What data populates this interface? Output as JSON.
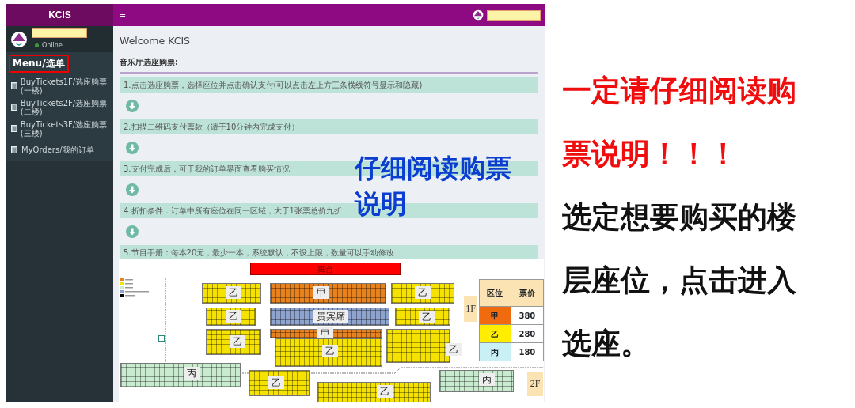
{
  "sidebar": {
    "brand": "KCIS",
    "user_status": "Online",
    "menu_title": "Menu/选单",
    "items": [
      {
        "label": "BuyTickets1F/选座购票(一楼)"
      },
      {
        "label": "BuyTickets2F/选座购票(二楼)"
      },
      {
        "label": "BuyTickets3F/选座购票(三楼)"
      },
      {
        "label": "MyOrders/我的订单"
      }
    ]
  },
  "topbar": {
    "menu_toggle": "≡"
  },
  "content": {
    "title": "Welcome KCIS",
    "section_title": "音乐厅选座购票:",
    "steps": [
      "1.点击选座购票，选择座位并点击确认支付(可以点击左上方三条横线符号显示和隐藏)",
      "2.扫描二维码支付票款（请于10分钟内完成支付）",
      "3.支付完成后，可于我的订单界面查看购买情况",
      "4.折扣条件：订单中所有座位在同一区域，大于1张票总价九折",
      "5.节目手册：每本20元，最少一本，系统默认，不设上限，数量可以手动修改"
    ],
    "overlay_note": "仔细阅读购票说明"
  },
  "seat_map": {
    "stage": "舞台",
    "zones": [
      {
        "label": "乙",
        "color": "#f5e200"
      },
      {
        "label": "甲",
        "color": "#e8821e"
      },
      {
        "label": "乙",
        "color": "#f5e200"
      },
      {
        "label": "乙",
        "color": "#f5e200"
      },
      {
        "label": "贵宾席",
        "color": "#8fa3cf"
      },
      {
        "label": "乙",
        "color": "#f5e200"
      },
      {
        "label": "乙",
        "color": "#f5e200"
      },
      {
        "label": "甲",
        "color": "#e8821e"
      },
      {
        "label": "乙",
        "color": "#f5e200"
      },
      {
        "label": "乙",
        "color": "#f5e200"
      },
      {
        "label": "丙",
        "color": "#c9ecd0"
      },
      {
        "label": "乙",
        "color": "#f5e200"
      },
      {
        "label": "乙",
        "color": "#f5e200"
      },
      {
        "label": "丙",
        "color": "#c9ecd0"
      }
    ],
    "floors": [
      "1F",
      "2F"
    ],
    "price_table": {
      "columns": [
        "区位",
        "票价"
      ],
      "rows": [
        {
          "zone": "甲",
          "price": "380",
          "color": "#f06a0f"
        },
        {
          "zone": "乙",
          "price": "280",
          "color": "#ffee00"
        },
        {
          "zone": "丙",
          "price": "180",
          "color": "#c8f0f5"
        }
      ]
    }
  },
  "annotations": [
    {
      "kind": "warning",
      "text": "一定请仔细阅读购票说明！！！"
    },
    {
      "kind": "instruction",
      "text": "选定想要购买的楼层座位，点击进入选座。"
    }
  ]
}
